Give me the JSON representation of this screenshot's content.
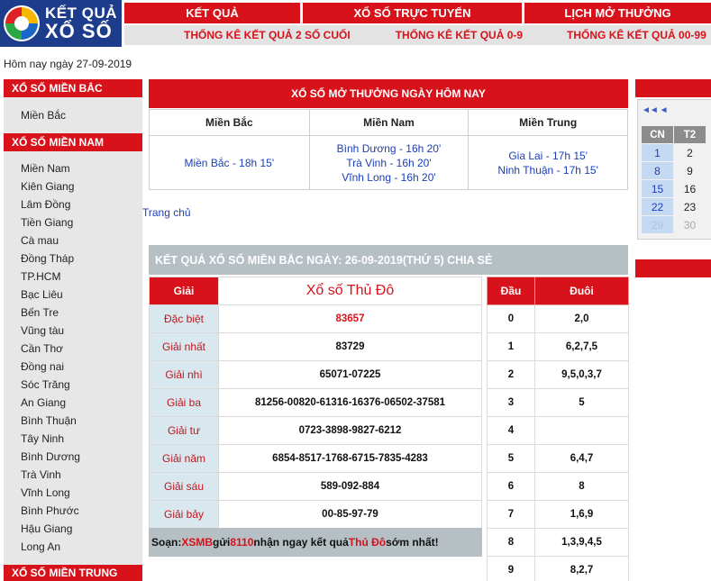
{
  "logo": {
    "line1": "KẾT QUẢ",
    "line2": "XỔ SỐ"
  },
  "topnav": [
    "KẾT QUẢ",
    "XỔ SỐ TRỰC TUYẾN",
    "LỊCH MỞ THƯỞNG"
  ],
  "subnav": [
    "THỐNG KÊ KẾT QUẢ 2 SỐ CUỐI",
    "THỐNG KÊ KẾT QUẢ 0-9",
    "THỐNG KÊ KẾT QUẢ 00-99"
  ],
  "today_label": "Hôm nay ngày 27-09-2019",
  "sidebar": {
    "mien_bac": {
      "title": "XỔ SỐ MIỀN BẮC",
      "items": [
        "Miền Bắc"
      ]
    },
    "mien_nam": {
      "title": "XỔ SỐ MIỀN NAM",
      "items": [
        "Miền Nam",
        "Kiên Giang",
        "Lâm Đồng",
        "Tiền Giang",
        "Cà mau",
        "Đồng Tháp",
        "TP.HCM",
        "Bạc Liêu",
        "Bến Tre",
        "Vũng tàu",
        "Cần Thơ",
        "Đồng nai",
        "Sóc Trăng",
        "An Giang",
        "Bình Thuận",
        "Tây Ninh",
        "Bình Dương",
        "Trà Vinh",
        "Vĩnh Long",
        "Bình Phước",
        "Hậu Giang",
        "Long An"
      ]
    },
    "mien_trung": {
      "title": "XỔ SỐ MIỀN TRUNG"
    }
  },
  "today_schedule": {
    "title": "XỔ SỐ MỞ THƯỞNG NGÀY HÔM NAY",
    "headers": [
      "Miền Bắc",
      "Miền Nam",
      "Miền Trung"
    ],
    "mien_bac": [
      "Miền Bắc - 18h 15'"
    ],
    "mien_nam": [
      "Bình Dương - 16h 20'",
      "Trà Vinh - 16h 20'",
      "Vĩnh Long - 16h 20'"
    ],
    "mien_trung": [
      "Gia Lai - 17h 15'",
      "Ninh Thuận - 17h 15'"
    ]
  },
  "breadcrumb": "Trang chủ",
  "results": {
    "title": "KẾT QUẢ XỔ SỐ MIỀN BẮC NGÀY: 26-09-2019(THỨ 5) CHIA SẺ",
    "col_label": "Giải",
    "lottery_name": "Xổ số Thủ Đô",
    "prizes": [
      {
        "name": "Đặc biệt",
        "value": "83657"
      },
      {
        "name": "Giải nhất",
        "value": "83729"
      },
      {
        "name": "Giải nhì",
        "value": "65071-07225"
      },
      {
        "name": "Giải ba",
        "value": "81256-00820-61316-16376-06502-37581"
      },
      {
        "name": "Giải tư",
        "value": "0723-3898-9827-6212"
      },
      {
        "name": "Giải năm",
        "value": "6854-8517-1768-6715-7835-4283"
      },
      {
        "name": "Giải sáu",
        "value": "589-092-884"
      },
      {
        "name": "Giải bảy",
        "value": "00-85-97-79"
      }
    ],
    "promo": {
      "p1": "Soạn: ",
      "code": "XSMB",
      "p2": " gửi ",
      "number": "8110",
      "p3": " nhận ngay kết quả ",
      "name": "Thủ Đô",
      "p4": " sớm nhất!"
    }
  },
  "loto": {
    "headers": [
      "Đầu",
      "Đuôi"
    ],
    "rows": [
      {
        "dau": "0",
        "duoi": "2,0"
      },
      {
        "dau": "1",
        "duoi": "6,2,7,5"
      },
      {
        "dau": "2",
        "duoi": "9,5,0,3,7"
      },
      {
        "dau": "3",
        "duoi": "5"
      },
      {
        "dau": "4",
        "duoi": ""
      },
      {
        "dau": "5",
        "duoi": "6,4,7"
      },
      {
        "dau": "6",
        "duoi": "8"
      },
      {
        "dau": "7",
        "duoi": "1,6,9"
      },
      {
        "dau": "8",
        "duoi": "1,3,9,4,5"
      },
      {
        "dau": "9",
        "duoi": "8,2,7"
      }
    ]
  },
  "calendar": {
    "nav": "◄◄ ◄",
    "headers": [
      "CN",
      "T2"
    ],
    "rows": [
      [
        "1",
        "2"
      ],
      [
        "8",
        "9"
      ],
      [
        "15",
        "16"
      ],
      [
        "22",
        "23"
      ],
      [
        "29",
        "30"
      ]
    ]
  }
}
